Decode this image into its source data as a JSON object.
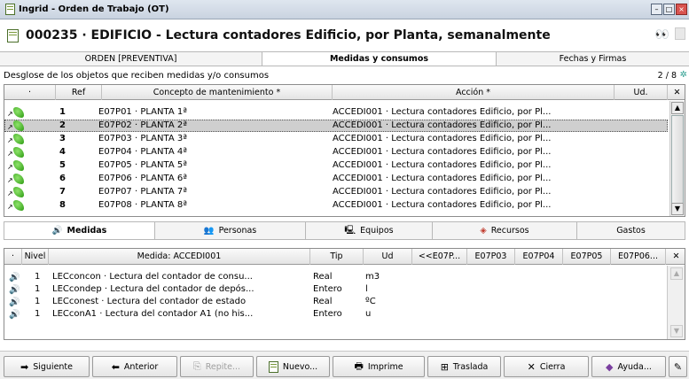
{
  "window": {
    "title": "Ingrid - Orden de Trabajo (OT)",
    "doc_icon": "document-icon"
  },
  "header": {
    "title": "000235 · EDIFICIO - Lectura contadores Edificio, por Planta, semanalmente"
  },
  "top_tabs": [
    {
      "label": "ORDEN [PREVENTIVA]"
    },
    {
      "label": "Medidas y consumos"
    },
    {
      "label": "Fechas y Firmas"
    }
  ],
  "breakdown": {
    "label": "Desglose de los objetos que reciben medidas y/o consumos",
    "counter": "2 / 8"
  },
  "grid": {
    "columns": {
      "flag": "·",
      "ref": "Ref",
      "concept": "Concepto de mantenimiento *",
      "action": "Acción *",
      "unit": "Ud."
    },
    "rows": [
      {
        "n": "1",
        "concept": "E07P01 · PLANTA 1ª",
        "action": "ACCEDI001 · Lectura contadores Edificio, por Pl..."
      },
      {
        "n": "2",
        "concept": "E07P02 · PLANTA 2ª",
        "action": "ACCEDI001 · Lectura contadores Edificio, por Pl..."
      },
      {
        "n": "3",
        "concept": "E07P03 · PLANTA 3ª",
        "action": "ACCEDI001 · Lectura contadores Edificio, por Pl..."
      },
      {
        "n": "4",
        "concept": "E07P04 · PLANTA 4ª",
        "action": "ACCEDI001 · Lectura contadores Edificio, por Pl..."
      },
      {
        "n": "5",
        "concept": "E07P05 · PLANTA 5ª",
        "action": "ACCEDI001 · Lectura contadores Edificio, por Pl..."
      },
      {
        "n": "6",
        "concept": "E07P06 · PLANTA 6ª",
        "action": "ACCEDI001 · Lectura contadores Edificio, por Pl..."
      },
      {
        "n": "7",
        "concept": "E07P07 · PLANTA 7ª",
        "action": "ACCEDI001 · Lectura contadores Edificio, por Pl..."
      },
      {
        "n": "8",
        "concept": "E07P08 · PLANTA 8ª",
        "action": "ACCEDI001 · Lectura contadores Edificio, por Pl..."
      }
    ]
  },
  "mid_tabs": [
    {
      "label": "Medidas"
    },
    {
      "label": "Personas"
    },
    {
      "label": "Equipos"
    },
    {
      "label": "Recursos"
    },
    {
      "label": "Gastos"
    }
  ],
  "grid2": {
    "columns": {
      "flag": "·",
      "nivel": "Nivel",
      "medida": "Medida: ACCEDI001",
      "tip": "Tip",
      "ud": "Ud",
      "c1": "<<E07P...",
      "c2": "E07P03",
      "c3": "E07P04",
      "c4": "E07P05",
      "c5": "E07P06..."
    },
    "rows": [
      {
        "nivel": "1",
        "medida": "LECconcon · Lectura del contador de consu...",
        "tip": "Real",
        "ud": "m3"
      },
      {
        "nivel": "1",
        "medida": "LECcondep · Lectura del contador de depós...",
        "tip": "Entero",
        "ud": "l"
      },
      {
        "nivel": "1",
        "medida": "LECconest · Lectura del contador de estado",
        "tip": "Real",
        "ud": "ºC"
      },
      {
        "nivel": "1",
        "medida": "LECconA1 · Lectura del contador A1 (no his...",
        "tip": "Entero",
        "ud": "u"
      }
    ]
  },
  "toolbar": {
    "siguiente": "Siguiente",
    "anterior": "Anterior",
    "repite": "Repite...",
    "nuevo": "Nuevo...",
    "imprime": "Imprime",
    "traslada": "Traslada",
    "cierra": "Cierra",
    "ayuda": "Ayuda..."
  },
  "colors": {
    "selected_row": "#cfcfcf",
    "leaf_green": "#2c9b12",
    "accent": "#2a9d8f"
  }
}
